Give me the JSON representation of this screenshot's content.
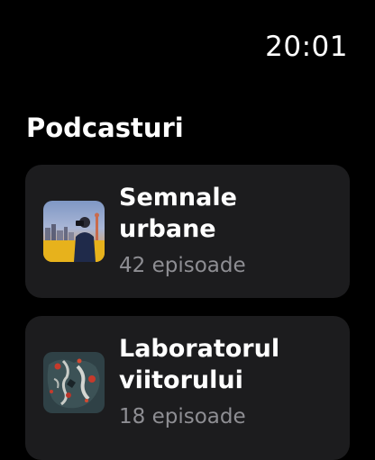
{
  "status": {
    "time": "20:01"
  },
  "screen": {
    "title": "Podcasturi"
  },
  "podcasts": [
    {
      "title": "Semnale urbane",
      "episodes": "42 episoade",
      "artwork": "city-skyline-photographer-artwork"
    },
    {
      "title": "Laboratorul viitorului",
      "episodes": "18 episoade",
      "artwork": "abstract-map-artwork"
    }
  ],
  "colors": {
    "background": "#000000",
    "card": "#1c1c1e",
    "primary_text": "#ffffff",
    "secondary_text": "#8e8e93"
  }
}
